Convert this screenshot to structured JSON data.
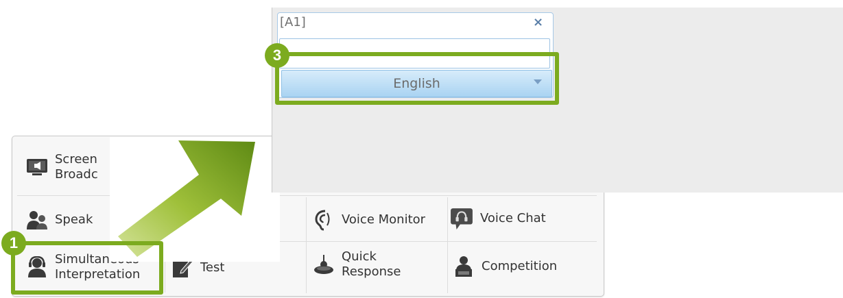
{
  "toolbar": {
    "items": {
      "screen_broadcast": {
        "line1": "Screen",
        "line2": "Broadc"
      },
      "speak": {
        "label": "Speak"
      },
      "voice_monitor": {
        "label": "Voice Monitor"
      },
      "voice_chat": {
        "label": "Voice Chat"
      },
      "simultaneous": {
        "line1": "Simultaneous",
        "line2": "Interpretation"
      },
      "test": {
        "label": "Test"
      },
      "quick_response": {
        "line1": "Quick",
        "line2": "Response"
      },
      "competition": {
        "label": "Competition"
      }
    }
  },
  "dialog": {
    "title": "[A1]",
    "close": "×",
    "input_value": "",
    "language_select": {
      "selected": "English"
    }
  },
  "callouts": {
    "step1": "1",
    "step3": "3"
  },
  "colors": {
    "highlight_green": "#7cab1f",
    "select_blue_top": "#d7ecfa",
    "select_blue_bottom": "#a9d3f2"
  },
  "icons": [
    "monitor-speaker-icon",
    "people-speak-icon",
    "ear-icon",
    "chat-bubble-icon",
    "headset-person-icon",
    "pen-test-icon",
    "buzzer-icon",
    "podium-person-icon",
    "green-arrow-icon"
  ]
}
